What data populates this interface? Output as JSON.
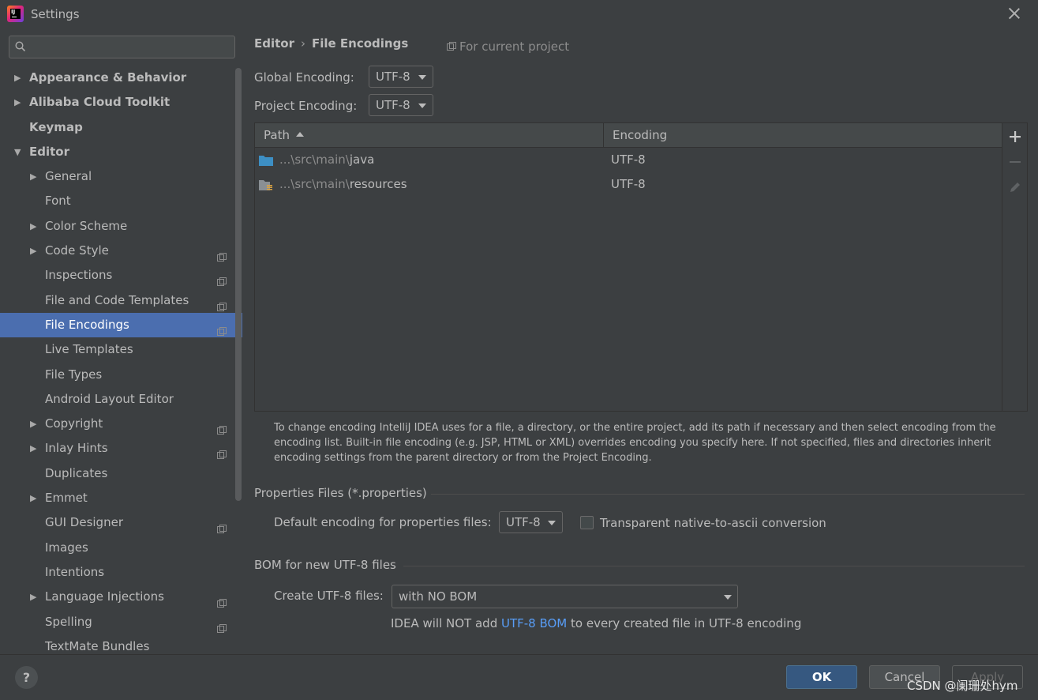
{
  "window": {
    "title": "Settings"
  },
  "sidebar": {
    "search": {
      "placeholder": "",
      "value": ""
    },
    "items": [
      {
        "label": "Appearance & Behavior",
        "level": 0,
        "arrow": "▶",
        "bold": true,
        "project": false,
        "selected": false
      },
      {
        "label": "Alibaba Cloud Toolkit",
        "level": 0,
        "arrow": "▶",
        "bold": true,
        "project": false,
        "selected": false
      },
      {
        "label": "Keymap",
        "level": 0,
        "arrow": "",
        "bold": true,
        "project": false,
        "selected": false
      },
      {
        "label": "Editor",
        "level": 0,
        "arrow": "▼",
        "bold": true,
        "project": false,
        "selected": false
      },
      {
        "label": "General",
        "level": 1,
        "arrow": "▶",
        "bold": false,
        "project": false,
        "selected": false
      },
      {
        "label": "Font",
        "level": 1,
        "arrow": "",
        "bold": false,
        "project": false,
        "selected": false
      },
      {
        "label": "Color Scheme",
        "level": 1,
        "arrow": "▶",
        "bold": false,
        "project": false,
        "selected": false
      },
      {
        "label": "Code Style",
        "level": 1,
        "arrow": "▶",
        "bold": false,
        "project": true,
        "selected": false
      },
      {
        "label": "Inspections",
        "level": 1,
        "arrow": "",
        "bold": false,
        "project": true,
        "selected": false
      },
      {
        "label": "File and Code Templates",
        "level": 1,
        "arrow": "",
        "bold": false,
        "project": true,
        "selected": false
      },
      {
        "label": "File Encodings",
        "level": 1,
        "arrow": "",
        "bold": false,
        "project": true,
        "selected": true
      },
      {
        "label": "Live Templates",
        "level": 1,
        "arrow": "",
        "bold": false,
        "project": false,
        "selected": false
      },
      {
        "label": "File Types",
        "level": 1,
        "arrow": "",
        "bold": false,
        "project": false,
        "selected": false
      },
      {
        "label": "Android Layout Editor",
        "level": 1,
        "arrow": "",
        "bold": false,
        "project": false,
        "selected": false
      },
      {
        "label": "Copyright",
        "level": 1,
        "arrow": "▶",
        "bold": false,
        "project": true,
        "selected": false
      },
      {
        "label": "Inlay Hints",
        "level": 1,
        "arrow": "▶",
        "bold": false,
        "project": true,
        "selected": false
      },
      {
        "label": "Duplicates",
        "level": 1,
        "arrow": "",
        "bold": false,
        "project": false,
        "selected": false
      },
      {
        "label": "Emmet",
        "level": 1,
        "arrow": "▶",
        "bold": false,
        "project": false,
        "selected": false
      },
      {
        "label": "GUI Designer",
        "level": 1,
        "arrow": "",
        "bold": false,
        "project": true,
        "selected": false
      },
      {
        "label": "Images",
        "level": 1,
        "arrow": "",
        "bold": false,
        "project": false,
        "selected": false
      },
      {
        "label": "Intentions",
        "level": 1,
        "arrow": "",
        "bold": false,
        "project": false,
        "selected": false
      },
      {
        "label": "Language Injections",
        "level": 1,
        "arrow": "▶",
        "bold": false,
        "project": true,
        "selected": false
      },
      {
        "label": "Spelling",
        "level": 1,
        "arrow": "",
        "bold": false,
        "project": true,
        "selected": false
      },
      {
        "label": "TextMate Bundles",
        "level": 1,
        "arrow": "",
        "bold": false,
        "project": false,
        "selected": false
      }
    ]
  },
  "breadcrumb": {
    "parent": "Editor",
    "separator": "›",
    "current": "File Encodings"
  },
  "scope_note": "For current project",
  "global_encoding": {
    "label": "Global Encoding:",
    "value": "UTF-8"
  },
  "project_encoding": {
    "label": "Project Encoding:",
    "value": "UTF-8"
  },
  "table": {
    "columns": {
      "path": "Path",
      "encoding": "Encoding"
    },
    "rows": [
      {
        "path_prefix": "...\\src\\main\\",
        "path_name": "java",
        "encoding": "UTF-8",
        "icon": "source-folder-icon"
      },
      {
        "path_prefix": "...\\src\\main\\",
        "path_name": "resources",
        "encoding": "UTF-8",
        "icon": "resources-folder-icon"
      }
    ]
  },
  "hint_text": "To change encoding IntelliJ IDEA uses for a file, a directory, or the entire project, add its path if necessary and then select encoding from the encoding list. Built-in file encoding (e.g. JSP, HTML or XML) overrides encoding you specify here. If not specified, files and directories inherit encoding settings from the parent directory or from the Project Encoding.",
  "properties": {
    "section_title": "Properties Files (*.properties)",
    "default_label": "Default encoding for properties files:",
    "default_value": "UTF-8",
    "native_to_ascii_label": "Transparent native-to-ascii conversion",
    "native_to_ascii_checked": false
  },
  "bom": {
    "section_title": "BOM for new UTF-8 files",
    "create_label": "Create UTF-8 files:",
    "create_value": "with NO BOM",
    "note_before": "IDEA will NOT add ",
    "note_link": "UTF-8 BOM",
    "note_after": " to every created file in UTF-8 encoding"
  },
  "footer": {
    "help": "?",
    "ok": "OK",
    "cancel": "Cancel",
    "apply": "Apply",
    "watermark": "CSDN @阑珊处hym"
  },
  "colors": {
    "selection": "#4b6eaf",
    "link": "#589df6",
    "ok_button": "#365880",
    "background": "#3c3f41"
  }
}
